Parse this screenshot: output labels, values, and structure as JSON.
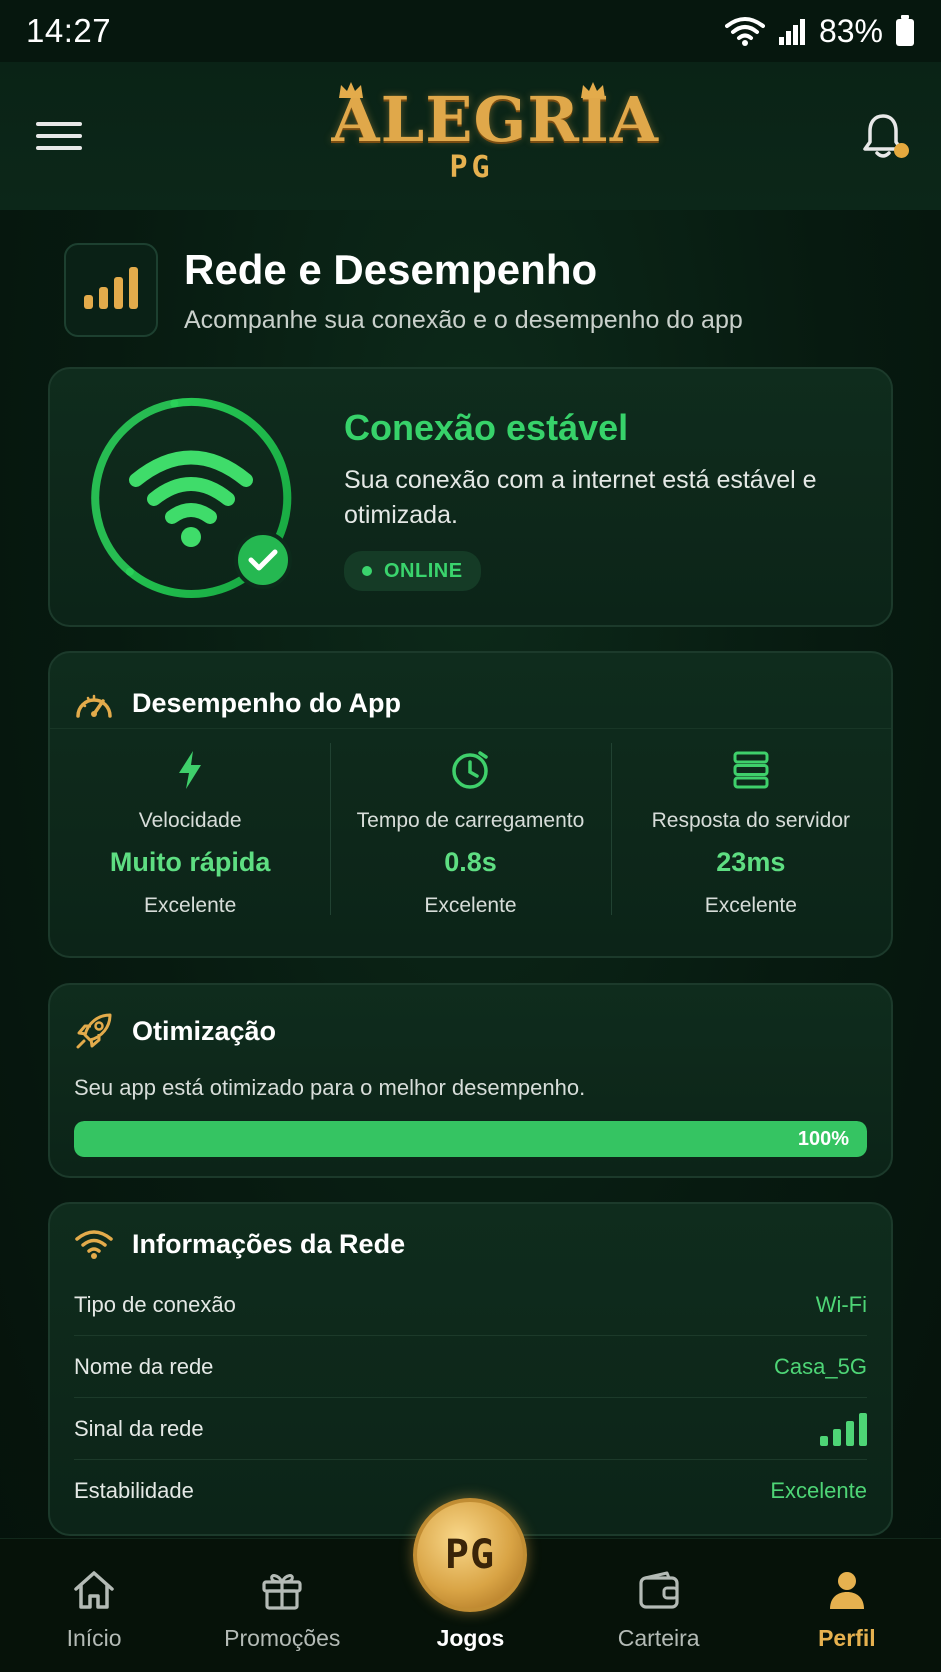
{
  "status_bar": {
    "time": "14:27",
    "battery": "83%"
  },
  "header": {
    "logo_main": "ALEGRIA",
    "logo_sub": "PG"
  },
  "page": {
    "title": "Rede e Desempenho",
    "subtitle": "Acompanhe sua conexão e o desempenho do app"
  },
  "connection": {
    "title": "Conexão estável",
    "description": "Sua conexão com a internet está estável e otimizada.",
    "badge": "ONLINE"
  },
  "performance": {
    "title": "Desempenho do App",
    "metrics": [
      {
        "icon": "lightning-icon",
        "label": "Velocidade",
        "value": "Muito rápida",
        "rating": "Excelente"
      },
      {
        "icon": "clock-icon",
        "label": "Tempo de carregamento",
        "value": "0.8s",
        "rating": "Excelente"
      },
      {
        "icon": "server-icon",
        "label": "Resposta do servidor",
        "value": "23ms",
        "rating": "Excelente"
      }
    ]
  },
  "optimization": {
    "title": "Otimização",
    "description": "Seu app está otimizado para o melhor desempenho.",
    "progress": 100,
    "progress_label": "100%"
  },
  "network_info": {
    "title": "Informações da Rede",
    "rows": [
      {
        "label": "Tipo de conexão",
        "value": "Wi-Fi"
      },
      {
        "label": "Nome da rede",
        "value": "Casa_5G"
      },
      {
        "label": "Sinal da rede",
        "value": "",
        "signal_level": 4
      },
      {
        "label": "Estabilidade",
        "value": "Excelente"
      }
    ]
  },
  "bottom_nav": {
    "items": [
      {
        "label": "Início",
        "icon": "home-icon"
      },
      {
        "label": "Promoções",
        "icon": "gift-icon"
      },
      {
        "label": "Jogos",
        "icon": "pg-coin-icon"
      },
      {
        "label": "Carteira",
        "icon": "wallet-icon"
      },
      {
        "label": "Perfil",
        "icon": "user-icon"
      }
    ],
    "center_coin_text": "PG",
    "active": "Perfil"
  },
  "colors": {
    "accent_green": "#37d26a",
    "gold": "#e6b14f",
    "background": "#071a10"
  }
}
